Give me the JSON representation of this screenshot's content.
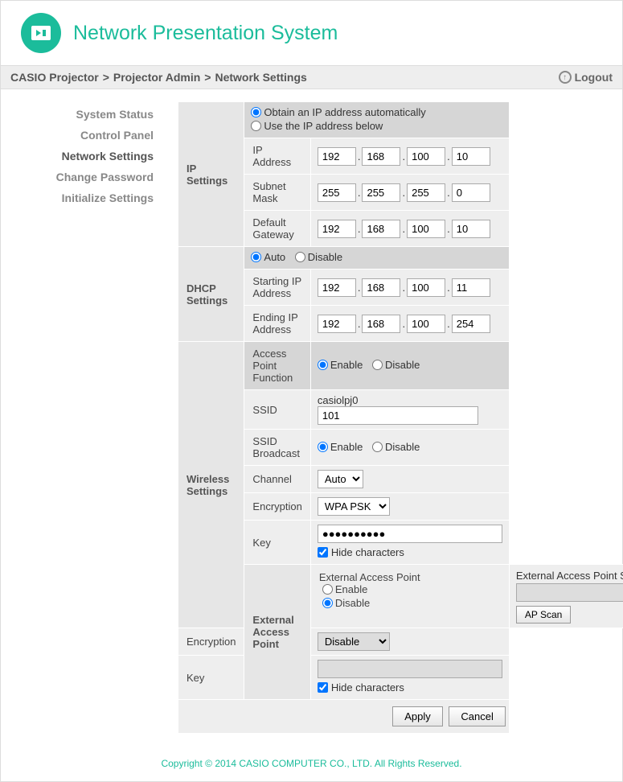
{
  "header": {
    "title": "Network Presentation System"
  },
  "breadcrumb": {
    "p1": "CASIO Projector",
    "sep": ">",
    "p2": "Projector Admin",
    "p3": "Network Settings"
  },
  "logout": "Logout",
  "sidebar": {
    "items": [
      {
        "label": "System Status"
      },
      {
        "label": "Control Panel"
      },
      {
        "label": "Network Settings"
      },
      {
        "label": "Change Password"
      },
      {
        "label": "Initialize Settings"
      }
    ]
  },
  "ip": {
    "section": "IP Settings",
    "radio_auto": "Obtain an IP address automatically",
    "radio_manual": "Use the IP address below",
    "addr_label": "IP Address",
    "addr": {
      "a": "192",
      "b": "168",
      "c": "100",
      "d": "10"
    },
    "subnet_label": "Subnet Mask",
    "subnet": {
      "a": "255",
      "b": "255",
      "c": "255",
      "d": "0"
    },
    "gateway_label": "Default Gateway",
    "gateway": {
      "a": "192",
      "b": "168",
      "c": "100",
      "d": "10"
    }
  },
  "dhcp": {
    "section": "DHCP Settings",
    "auto": "Auto",
    "disable": "Disable",
    "start_label": "Starting IP Address",
    "start": {
      "a": "192",
      "b": "168",
      "c": "100",
      "d": "11"
    },
    "end_label": "Ending IP Address",
    "end": {
      "a": "192",
      "b": "168",
      "c": "100",
      "d": "254"
    }
  },
  "wireless": {
    "section": "Wireless Settings",
    "ap_label": "Access Point Function",
    "enable": "Enable",
    "disable": "Disable",
    "ssid_label": "SSID",
    "ssid_prefix": "casiolpj0",
    "ssid_value": "101",
    "broadcast_label": "SSID Broadcast",
    "channel_label": "Channel",
    "channel_value": "Auto",
    "encryption_label": "Encryption",
    "encryption_value": "WPA PSK",
    "key_label": "Key",
    "key_value": "●●●●●●●●●●",
    "hide_label": "Hide characters"
  },
  "external": {
    "section": "External Access Point",
    "ap_label": "External Access Point",
    "enable": "Enable",
    "disable": "Disable",
    "ssid_label": "External Access Point SSID",
    "ssid_value": "",
    "apscan": "AP Scan",
    "encryption_label": "Encryption",
    "encryption_value": "Disable",
    "key_label": "Key",
    "key_value": "",
    "hide_label": "Hide characters"
  },
  "buttons": {
    "apply": "Apply",
    "cancel": "Cancel"
  },
  "footer": "Copyright © 2014 CASIO COMPUTER CO., LTD. All Rights Reserved."
}
